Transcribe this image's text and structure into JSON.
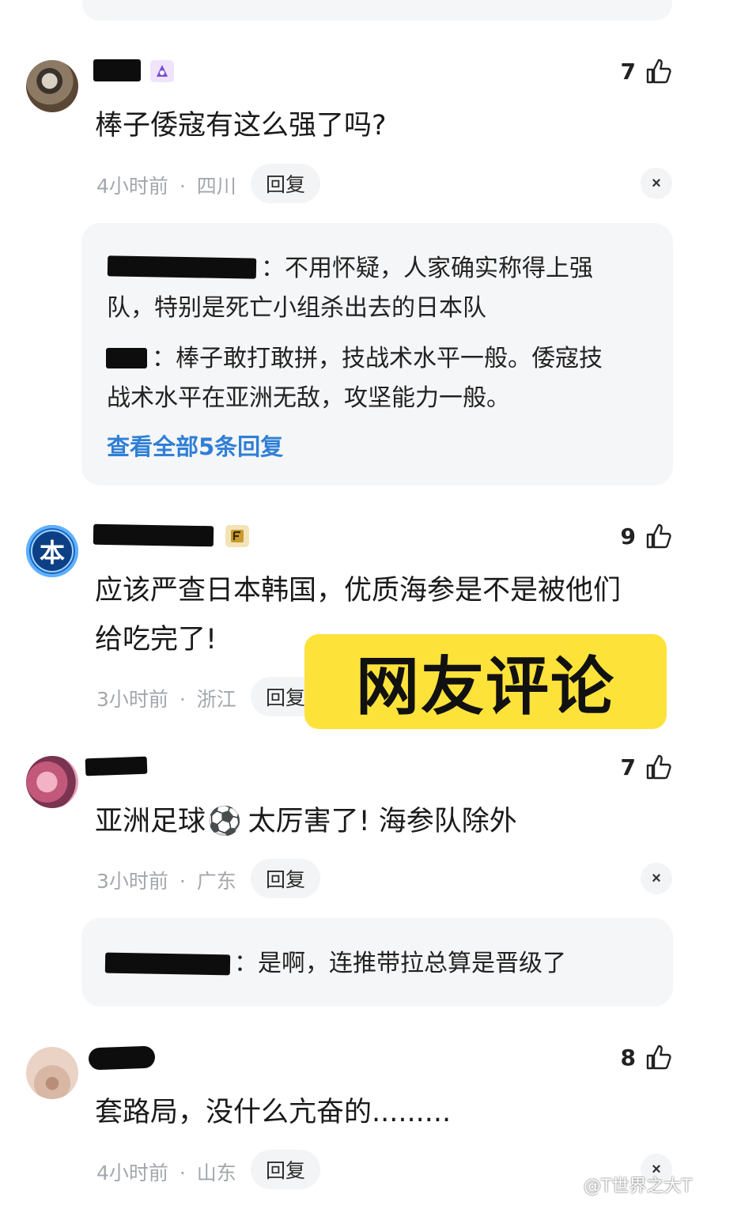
{
  "comments": [
    {
      "likes": "7",
      "text": "棒子倭寇有这么强了吗?",
      "time": "4小时前",
      "location": "四川",
      "replies": [
        {
          "lines": [
            "：不用怀疑，人家确实称得上强",
            "队，特别是死亡小组杀出去的日本队"
          ]
        },
        {
          "lines": [
            "：棒子敢打敢拼，技战术水平一般。倭寇技",
            "战术水平在亚洲无敌，攻坚能力一般。"
          ]
        }
      ],
      "view_all": "查看全部5条回复"
    },
    {
      "likes": "9",
      "avatar_char": "本",
      "text_line1": "应该严查日本韩国，优质海参是不是被他们",
      "text_line2": "给吃完了!",
      "time": "3小时前",
      "location": "浙江"
    },
    {
      "likes": "7",
      "text_pre": "亚洲足球",
      "emoji": "⚽",
      "text_post": "太厉害了! 海参队除外",
      "time": "3小时前",
      "location": "广东",
      "replies": [
        {
          "lines": [
            "：是啊，连推带拉总算是晋级了"
          ]
        }
      ]
    },
    {
      "likes": "8",
      "text": "套路局，没什么亢奋的.........",
      "time": "4小时前",
      "location": "山东"
    }
  ],
  "reply_label": "回复",
  "meta_separator": "·",
  "close_label": "×",
  "banner_text": "网友评论",
  "watermark": "@T世界之大T",
  "icons": {
    "like": "thumbs-up-icon",
    "close": "close-icon",
    "badge_purple": "#7b4bd6",
    "badge_gold": "#c99a2e"
  }
}
